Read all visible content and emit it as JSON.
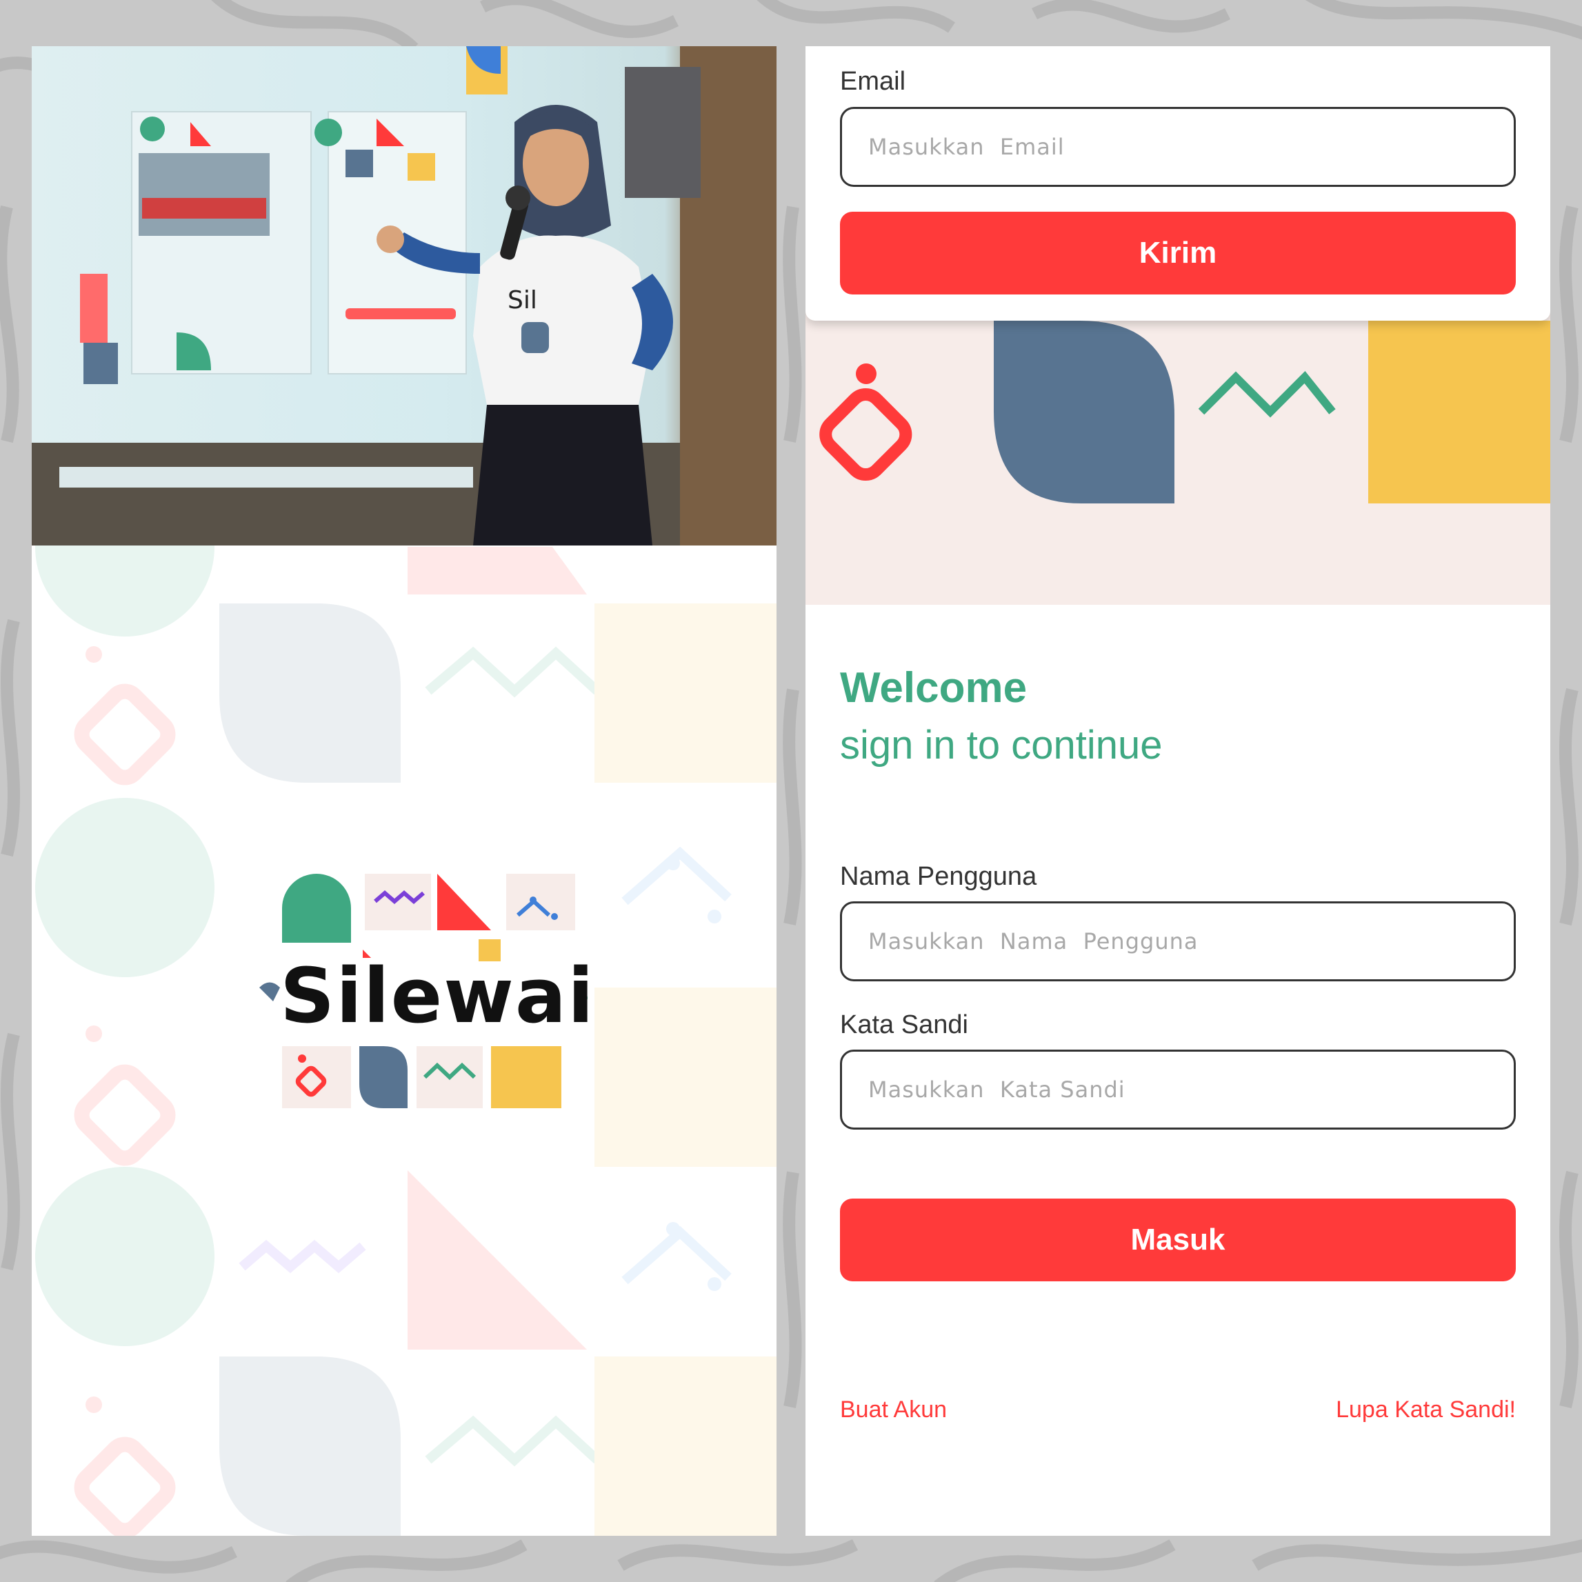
{
  "colors": {
    "primary_red": "#ff3a3a",
    "brand_green": "#3fa882",
    "brand_blue": "#587491",
    "brand_yellow": "#f6c54f",
    "pink_band": "#f7ece9",
    "outer_background": "#c8c8c8"
  },
  "brand": {
    "logo_text": "Silewai"
  },
  "reset_form": {
    "email_label": "Email",
    "email_placeholder": "Masukkan  Email",
    "submit_label": "Kirim"
  },
  "login": {
    "welcome_title": "Welcome",
    "welcome_subtitle": "sign in to continue",
    "username_label": "Nama Pengguna",
    "username_placeholder": "Masukkan  Nama  Pengguna",
    "password_label": "Kata Sandi",
    "password_placeholder": "Masukkan  Kata Sandi",
    "submit_label": "Masuk",
    "create_account_link": "Buat Akun",
    "forgot_password_link": "Lupa Kata Sandi!"
  },
  "icons": {
    "decor": [
      "dot-diamond-icon",
      "leaf-shape-icon",
      "zigzag-icon",
      "yellow-square-icon",
      "circle-icon",
      "triangle-icon",
      "wave-icon",
      "mountain-dot-icon"
    ]
  }
}
